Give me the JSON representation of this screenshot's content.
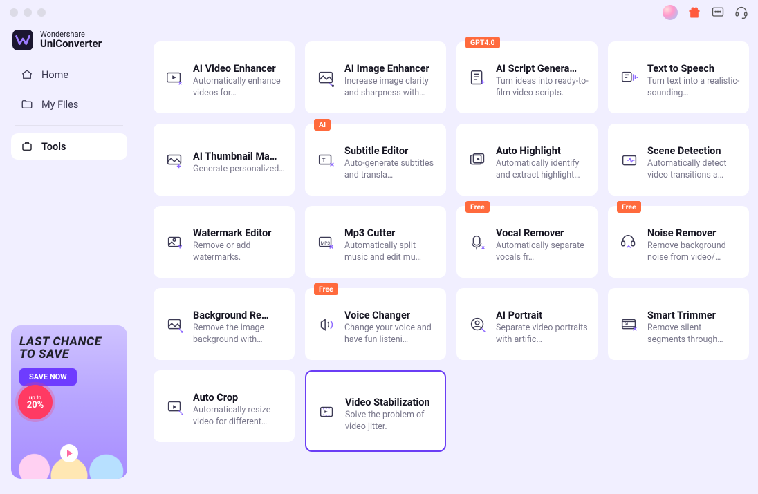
{
  "brand": {
    "top": "Wondershare",
    "main": "UniConverter"
  },
  "nav": {
    "home": "Home",
    "myfiles": "My Files",
    "tools": "Tools"
  },
  "promo": {
    "line1": "LAST CHANCE",
    "line2": "TO SAVE",
    "cta": "SAVE NOW",
    "burst_top": "up to",
    "burst_val": "20%"
  },
  "badges": {
    "gpt": "GPT4.0",
    "ai": "AI",
    "free": "Free"
  },
  "tools": [
    {
      "id": "ai-video-enhancer",
      "title": "AI Video Enhancer",
      "desc": "Automatically enhance videos for…",
      "badge": null
    },
    {
      "id": "ai-image-enhancer",
      "title": "AI Image Enhancer",
      "desc": "Increase image clarity and sharpness with…",
      "badge": null
    },
    {
      "id": "ai-script-generator",
      "title": "AI Script Genera…",
      "desc": "Turn ideas into ready-to-film video scripts.",
      "badge": "gpt"
    },
    {
      "id": "text-to-speech",
      "title": "Text to Speech",
      "desc": "Turn text into a realistic-sounding…",
      "badge": null
    },
    {
      "id": "ai-thumbnail-maker",
      "title": "AI Thumbnail Ma…",
      "desc": "Generate personalized…",
      "badge": null
    },
    {
      "id": "subtitle-editor",
      "title": "Subtitle Editor",
      "desc": "Auto-generate subtitles and transla…",
      "badge": "ai"
    },
    {
      "id": "auto-highlight",
      "title": "Auto Highlight",
      "desc": "Automatically identify and extract highlight…",
      "badge": null
    },
    {
      "id": "scene-detection",
      "title": "Scene Detection",
      "desc": "Automatically detect video transitions a…",
      "badge": null
    },
    {
      "id": "watermark-editor",
      "title": "Watermark Editor",
      "desc": "Remove or add watermarks.",
      "badge": null
    },
    {
      "id": "mp3-cutter",
      "title": "Mp3 Cutter",
      "desc": "Automatically split music and edit mu…",
      "badge": null
    },
    {
      "id": "vocal-remover",
      "title": "Vocal Remover",
      "desc": "Automatically separate vocals fr…",
      "badge": "free"
    },
    {
      "id": "noise-remover",
      "title": "Noise Remover",
      "desc": "Remove background noise from video/…",
      "badge": "free"
    },
    {
      "id": "background-remover",
      "title": "Background Re…",
      "desc": "Remove the image background with…",
      "badge": null
    },
    {
      "id": "voice-changer",
      "title": "Voice Changer",
      "desc": "Change your voice and have fun listeni…",
      "badge": "free"
    },
    {
      "id": "ai-portrait",
      "title": "AI Portrait",
      "desc": "Separate video portraits with artific…",
      "badge": null
    },
    {
      "id": "smart-trimmer",
      "title": "Smart Trimmer",
      "desc": "Remove silent segments through…",
      "badge": null
    },
    {
      "id": "auto-crop",
      "title": "Auto Crop",
      "desc": "Automatically resize video for different…",
      "badge": null
    },
    {
      "id": "video-stabilization",
      "title": "Video Stabilization",
      "desc": "Solve the problem of video jitter.",
      "badge": null,
      "selected": true
    }
  ]
}
